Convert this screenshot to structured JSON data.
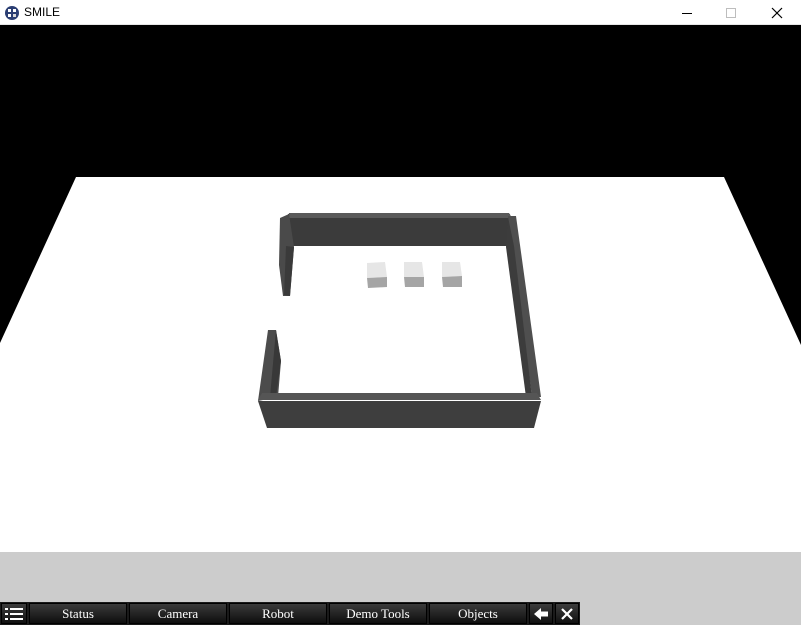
{
  "window": {
    "title": "SMILE",
    "controls": [
      "minimize",
      "maximize",
      "close"
    ]
  },
  "scene": {
    "sky_color": "#000000",
    "floor_color": "#ffffff",
    "wall_color": "#454545",
    "cube_color": "#bdbdbd",
    "cube_count": 3
  },
  "menubar": {
    "background": "#cccccc",
    "items": [
      {
        "label": "Status"
      },
      {
        "label": "Camera"
      },
      {
        "label": "Robot"
      },
      {
        "label": "Demo Tools"
      },
      {
        "label": "Objects"
      }
    ],
    "icons": [
      "menu-list-icon",
      "back-arrow-icon",
      "close-x-icon"
    ]
  }
}
